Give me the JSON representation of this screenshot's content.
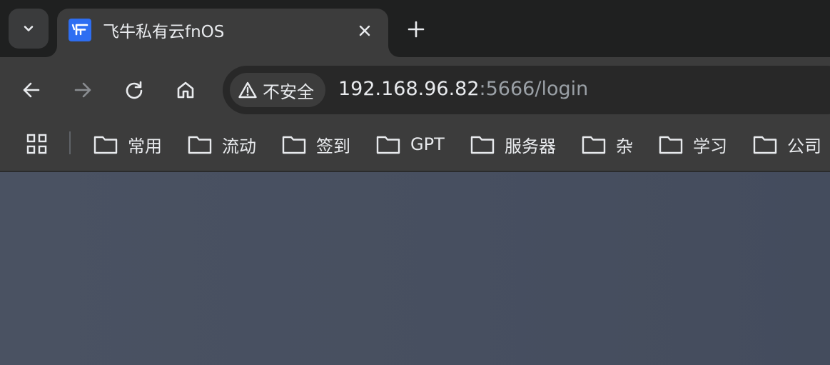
{
  "tabstrip": {
    "tab_search_icon": "chevron-down-icon",
    "active_tab": {
      "title": "飞牛私有云fnOS",
      "favicon_icon": "fnos-logo-icon",
      "favicon_color": "#2e6ef2",
      "close_icon": "close-icon"
    },
    "new_tab_icon": "plus-icon"
  },
  "toolbar": {
    "back_icon": "arrow-left-icon",
    "forward_icon": "arrow-right-icon",
    "reload_icon": "reload-icon",
    "home_icon": "home-icon",
    "security": {
      "icon": "warning-triangle-icon",
      "label": "不安全"
    },
    "url": {
      "host": "192.168.96.82",
      "rest": ":5666/login"
    }
  },
  "bookmarks": {
    "apps_icon": "apps-grid-icon",
    "items": [
      {
        "label": "常用",
        "icon": "folder-icon"
      },
      {
        "label": "流动",
        "icon": "folder-icon"
      },
      {
        "label": "签到",
        "icon": "folder-icon"
      },
      {
        "label": "GPT",
        "icon": "folder-icon"
      },
      {
        "label": "服务器",
        "icon": "folder-icon"
      },
      {
        "label": "杂",
        "icon": "folder-icon"
      },
      {
        "label": "学习",
        "icon": "folder-icon"
      },
      {
        "label": "公司",
        "icon": "folder-icon"
      }
    ]
  },
  "colors": {
    "tabstrip_bg": "#1f2020",
    "toolbar_bg": "#3c3c3c",
    "omnibox_bg": "#282828",
    "page_bg": "#474f60"
  }
}
